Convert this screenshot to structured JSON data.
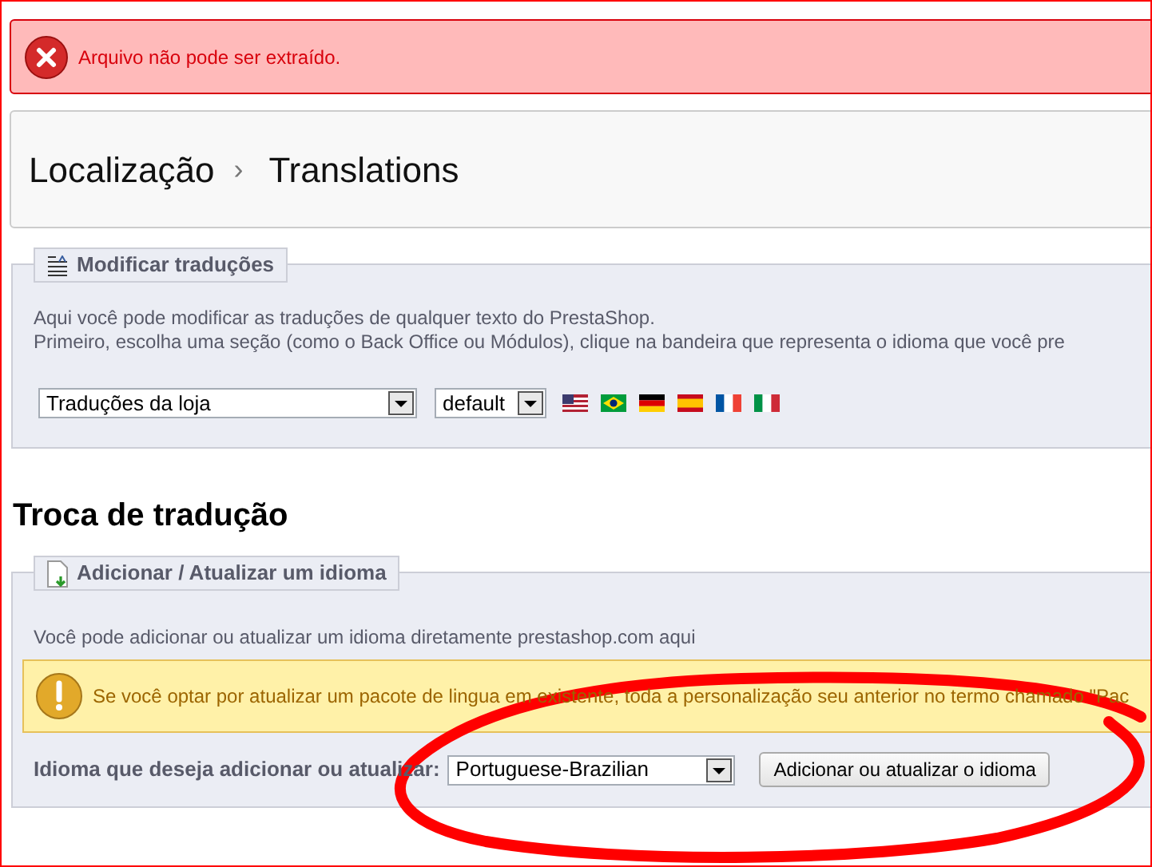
{
  "error": {
    "message": "Arquivo não pode ser extraído."
  },
  "breadcrumb": {
    "parent": "Localização",
    "separator": "›",
    "current": "Translations"
  },
  "modify": {
    "legend": "Modificar traduções",
    "lines": [
      "Aqui você pode modificar as traduções de qualquer texto do PrestaShop.",
      "Primeiro, escolha uma seção (como o Back Office ou Módulos), clique na bandeira que representa o idioma que você pre"
    ],
    "type_select": {
      "value": "Traduções da loja"
    },
    "theme_select": {
      "value": "default"
    }
  },
  "section_title": "Troca de tradução",
  "add": {
    "legend": "Adicionar / Atualizar um idioma",
    "intro": "Você pode adicionar ou atualizar um idioma diretamente prestashop.com aqui",
    "warning": "Se você optar por atualizar um pacote de lingua em existente, toda a personalização seu anterior no termo chamado \"Pac",
    "label": "Idioma que deseja adicionar ou atualizar:",
    "language_select": {
      "value": "Portuguese-Brazilian"
    },
    "button": "Adicionar ou atualizar o idioma"
  }
}
